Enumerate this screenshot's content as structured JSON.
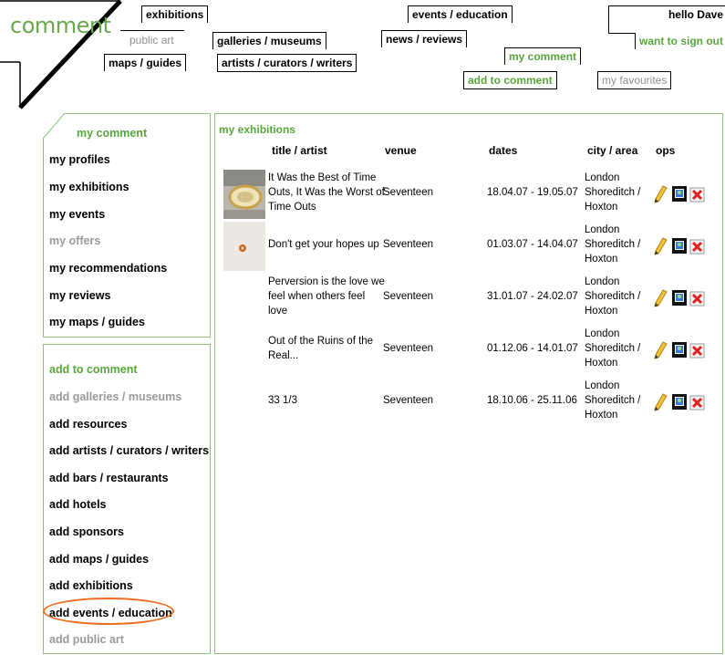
{
  "logo": {
    "text": "comment"
  },
  "header": {
    "nav": {
      "exhibitions": "exhibitions",
      "public_art": "public art",
      "maps_guides": "maps / guides",
      "galleries_museums": "galleries / museums",
      "artists": "artists / curators / writers",
      "events_education": "events / education",
      "news_reviews": "news / reviews",
      "my_comment": "my comment",
      "add_to_comment": "add to comment",
      "my_favourites": "my favourites"
    },
    "user": {
      "greeting": "hello Dave",
      "sign_out": "want to sign out"
    }
  },
  "sidebar": {
    "my_section": {
      "title": "my comment",
      "items": [
        "my profiles",
        "my exhibitions",
        "my events",
        "my offers",
        "my recommendations",
        "my reviews",
        "my maps / guides"
      ]
    },
    "add_section": {
      "title": "add to comment",
      "items": [
        "add galleries / museums",
        "add resources",
        "add artists / curators / writers",
        "add bars / restaurants",
        "add hotels",
        "add sponsors",
        "add maps / guides",
        "add exhibitions",
        "add events / education",
        "add public art"
      ]
    }
  },
  "main": {
    "title": "my exhibitions",
    "columns": [
      "title / artist",
      "venue",
      "dates",
      "city / area",
      "ops"
    ],
    "rows": [
      {
        "title": [
          "It Was the Best of Time",
          "Outs, It Was the Worst of",
          "Time Outs"
        ],
        "venue": "Seventeen",
        "dates": "18.04.07 - 19.05.07",
        "city": [
          "London",
          "Shoreditch /",
          "Hoxton"
        ]
      },
      {
        "title": [
          "Don't get your hopes up"
        ],
        "venue": "Seventeen",
        "dates": "01.03.07 - 14.04.07",
        "city": [
          "London",
          "Shoreditch /",
          "Hoxton"
        ]
      },
      {
        "title": [
          "Perversion is the love we",
          "feel when others feel",
          "love"
        ],
        "venue": "Seventeen",
        "dates": "31.01.07 - 24.02.07",
        "city": [
          "London",
          "Shoreditch /",
          "Hoxton"
        ]
      },
      {
        "title": [
          "Out of the Ruins of the",
          "Real..."
        ],
        "venue": "Seventeen",
        "dates": "01.12.06 - 14.01.07",
        "city": [
          "London",
          "Shoreditch /",
          "Hoxton"
        ]
      },
      {
        "title": [
          "33 1/3"
        ],
        "venue": "Seventeen",
        "dates": "18.10.06 - 25.11.06",
        "city": [
          "London",
          "Shoreditch /",
          "Hoxton"
        ]
      }
    ]
  },
  "colors": {
    "accent_green": "#59a53d",
    "border_green": "#8cc47a",
    "highlight_orange": "#ec6b1c",
    "muted_grey": "#9a9a9a"
  },
  "icons": {
    "edit": "pencil-icon",
    "view": "view-icon",
    "delete": "delete-icon"
  }
}
